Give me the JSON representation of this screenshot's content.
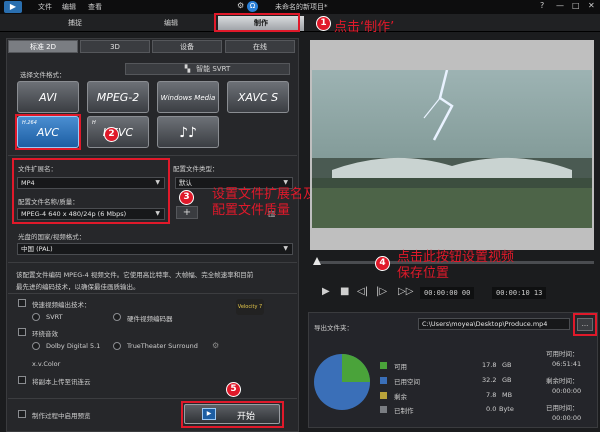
{
  "app": {
    "menu": [
      "文件",
      "编辑",
      "查看"
    ],
    "title": "未命名的新项目*",
    "window_buttons": [
      "?",
      "—",
      "□",
      "✕"
    ]
  },
  "mode_tabs": [
    "捕捉",
    "编辑",
    "制作"
  ],
  "sub_tabs": [
    "标准 2D",
    "3D",
    "设备",
    "在线"
  ],
  "format_section": {
    "label": "选择文件格式：",
    "smart_svrt": "智能 SVRT",
    "formats_row1": [
      "AVI",
      "MPEG-2",
      "Windows Media",
      "XAVC S"
    ],
    "formats_row2": [
      {
        "small": "H.264",
        "big": "AVC"
      },
      {
        "small": "H",
        "big": "HEVC"
      },
      {
        "small": "",
        "big": "♪♪"
      }
    ]
  },
  "ext": {
    "label": "文件扩展名：",
    "value": "MP4",
    "profile_label": "配置文件名称/质量：",
    "profile_value": "MPEG-4 640 x 480/24p (6 Mbps)",
    "profile_type_label": "配置文件类型：",
    "profile_type_value": "默认",
    "add_btn": "+"
  },
  "country": {
    "label": "光盘的国家/视频格式：",
    "value": "中国 (PAL)"
  },
  "description": {
    "line1": "该配置文件编码 MPEG-4 视频文件。它使用高比特率、大帧幅、完全帧速率和目前",
    "line2": "最先进的编码技术，以确保最佳画质输出。"
  },
  "options": {
    "hw_accel": "快速视频编出技术：",
    "svrt": "SVRT",
    "hw_encoder": "硬件视频编码器",
    "surround": "环绕音效",
    "dolby": "Dolby Digital 5.1",
    "truetheater": "TrueTheater Surround",
    "xvcolor": "x.v.Color",
    "upload": "将副本上传至讯连云",
    "preview_check": "制作过程中启用预览"
  },
  "start_button": "开始",
  "annotations": {
    "a1_num": "1",
    "a1_text": "点击‘制作’",
    "a2_num": "2",
    "a3_num": "3",
    "a3_text1": "设置文件扩展名及",
    "a3_text2": "配置文件质量",
    "a4_num": "4",
    "a4_text1": "点击此按钮设置视频",
    "a4_text2": "保存位置",
    "a5_num": "5"
  },
  "playback": {
    "time_current": "00:00:00 00",
    "time_total": "00:00:10 13"
  },
  "export": {
    "folder_label": "导出文件夹：",
    "folder_path": "C:\\Users\\moyea\\Desktop\\Produce.mp4",
    "browse_btn": "...",
    "legend": [
      {
        "label": "可用",
        "value": "17.8",
        "unit": "GB",
        "color": "#4aa33a"
      },
      {
        "label": "已用空间",
        "value": "32.2",
        "unit": "GB",
        "color": "#3a6fb8"
      },
      {
        "label": "剩余",
        "value": "7.8",
        "unit": "MB",
        "color": "#b8a23a"
      },
      {
        "label": "已制作",
        "value": "0.0",
        "unit": "Byte",
        "color": "#7a7d82"
      }
    ],
    "times": [
      {
        "label": "可用时间：",
        "value": "06:51:41"
      },
      {
        "label": "剩余时间：",
        "value": "00:00:00"
      },
      {
        "label": "已用时间：",
        "value": "00:00:00"
      }
    ]
  }
}
